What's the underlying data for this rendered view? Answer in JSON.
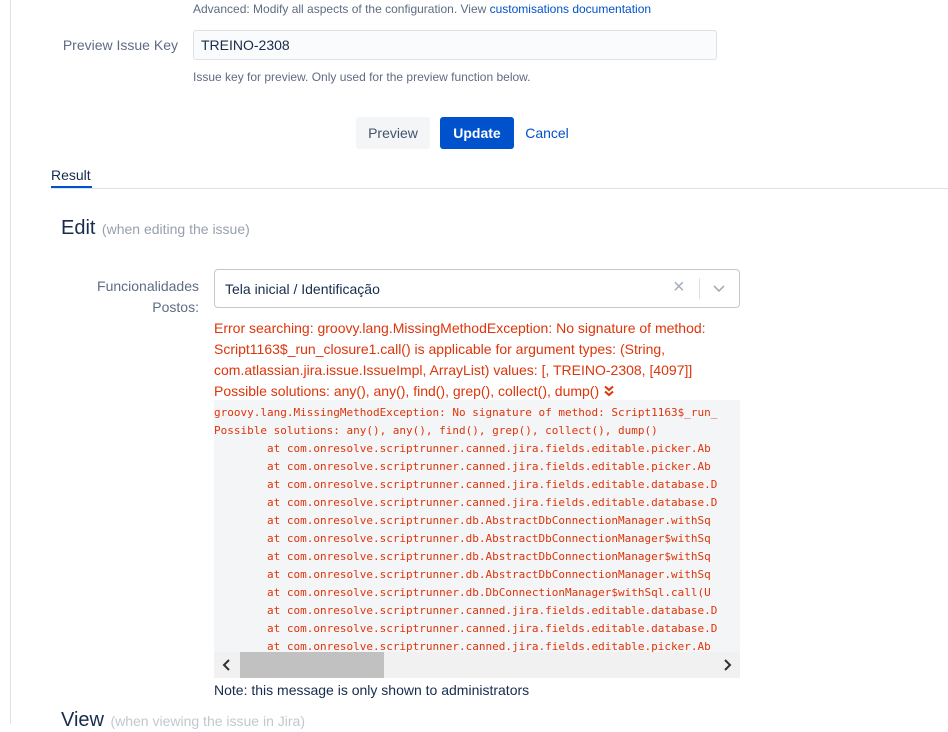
{
  "config": {
    "advanced_desc": "Advanced: Modify all aspects of the configuration. View",
    "docs_link": "customisations documentation"
  },
  "preview_issue_key": {
    "label": "Preview Issue Key",
    "value": "TREINO-2308",
    "help": "Issue key for preview. Only used for the preview function below."
  },
  "actions": {
    "preview": "Preview",
    "update": "Update",
    "cancel": "Cancel"
  },
  "tabs": [
    {
      "label": "Result",
      "active": true
    }
  ],
  "edit": {
    "heading": "Edit",
    "subheading": "(when editing the issue)",
    "field_label": "Funcionalidades Postos:",
    "selected_value": "Tela inicial / Identificação",
    "clear_icon": "close-icon",
    "dropdown_icon": "chevron-down-icon",
    "error": "Error searching: groovy.lang.MissingMethodException: No signature of method: Script1163$_run_closure1.call() is applicable for argument types: (String, com.atlassian.jira.issue.IssueImpl, ArrayList) values: [, TREINO-2308, [4097]] Possible solutions: any(), any(), find(), grep(), collect(), dump()",
    "expand_icon": "double-chevron-down-icon",
    "stack_trace": [
      "groovy.lang.MissingMethodException: No signature of method: Script1163$_run_",
      "Possible solutions: any(), any(), find(), grep(), collect(), dump()",
      "\tat com.onresolve.scriptrunner.canned.jira.fields.editable.picker.Ab",
      "\tat com.onresolve.scriptrunner.canned.jira.fields.editable.picker.Ab",
      "\tat com.onresolve.scriptrunner.canned.jira.fields.editable.database.D",
      "\tat com.onresolve.scriptrunner.canned.jira.fields.editable.database.D",
      "\tat com.onresolve.scriptrunner.db.AbstractDbConnectionManager.withSq",
      "\tat com.onresolve.scriptrunner.db.AbstractDbConnectionManager$withSq",
      "\tat com.onresolve.scriptrunner.db.AbstractDbConnectionManager$withSq",
      "\tat com.onresolve.scriptrunner.db.AbstractDbConnectionManager.withSq",
      "\tat com.onresolve.scriptrunner.db.DbConnectionManager$withSql.call(U",
      "\tat com.onresolve.scriptrunner.canned.jira.fields.editable.database.D",
      "\tat com.onresolve.scriptrunner.canned.jira.fields.editable.database.D",
      "\tat com.onresolve.scriptrunner.canned.jira.fields.editable.picker.Ab"
    ],
    "admin_note": "Note: this message is only shown to administrators"
  },
  "view": {
    "heading": "View",
    "subheading": "(when viewing the issue in Jira)"
  },
  "colors": {
    "accent": "#0052cc",
    "error": "#de350b",
    "muted": "#5e6c84"
  }
}
